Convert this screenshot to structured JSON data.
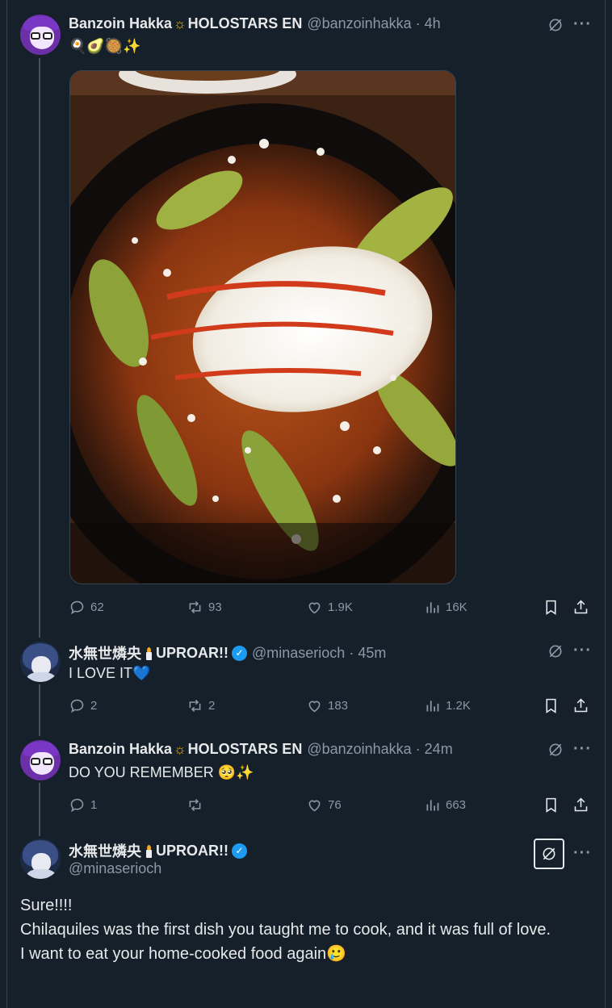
{
  "posts": [
    {
      "name": "Banzoin Hakka",
      "name_suffix": "HOLOSTARS EN",
      "handle": "@banzoinhakka",
      "time": "4h",
      "emoji_text": "🍳🥑🥘✨",
      "stats": {
        "replies": "62",
        "reposts": "93",
        "likes": "1.9K",
        "views": "16K"
      }
    },
    {
      "name": "水無世燐央",
      "name_suffix": "UPROAR!!",
      "handle": "@minaserioch",
      "time": "45m",
      "text": "I LOVE IT💙",
      "stats": {
        "replies": "2",
        "reposts": "2",
        "likes": "183",
        "views": "1.2K"
      }
    },
    {
      "name": "Banzoin Hakka",
      "name_suffix": "HOLOSTARS EN",
      "handle": "@banzoinhakka",
      "time": "24m",
      "text": "DO YOU REMEMBER 🥺✨",
      "stats": {
        "replies": "1",
        "reposts": "",
        "likes": "76",
        "views": "663"
      }
    }
  ],
  "focused": {
    "name": "水無世燐央",
    "name_suffix": "UPROAR!!",
    "handle": "@minaserioch",
    "lines": [
      "Sure!!!!",
      "Chilaquiles was the first dish you taught me to cook, and it was full of love.",
      "I want to eat your home-cooked food again🥲"
    ]
  },
  "separator_dot": "·",
  "more_label": "···",
  "colors": {
    "background": "#15202b",
    "muted": "#8b98a5",
    "verified": "#1d9bf0",
    "text": "#e7e9ea"
  },
  "icons": [
    "reply-icon",
    "repost-icon",
    "like-icon",
    "views-icon",
    "bookmark-icon",
    "share-icon",
    "grok-icon",
    "more-icon",
    "verified-icon",
    "sun-icon",
    "candle-icon"
  ]
}
